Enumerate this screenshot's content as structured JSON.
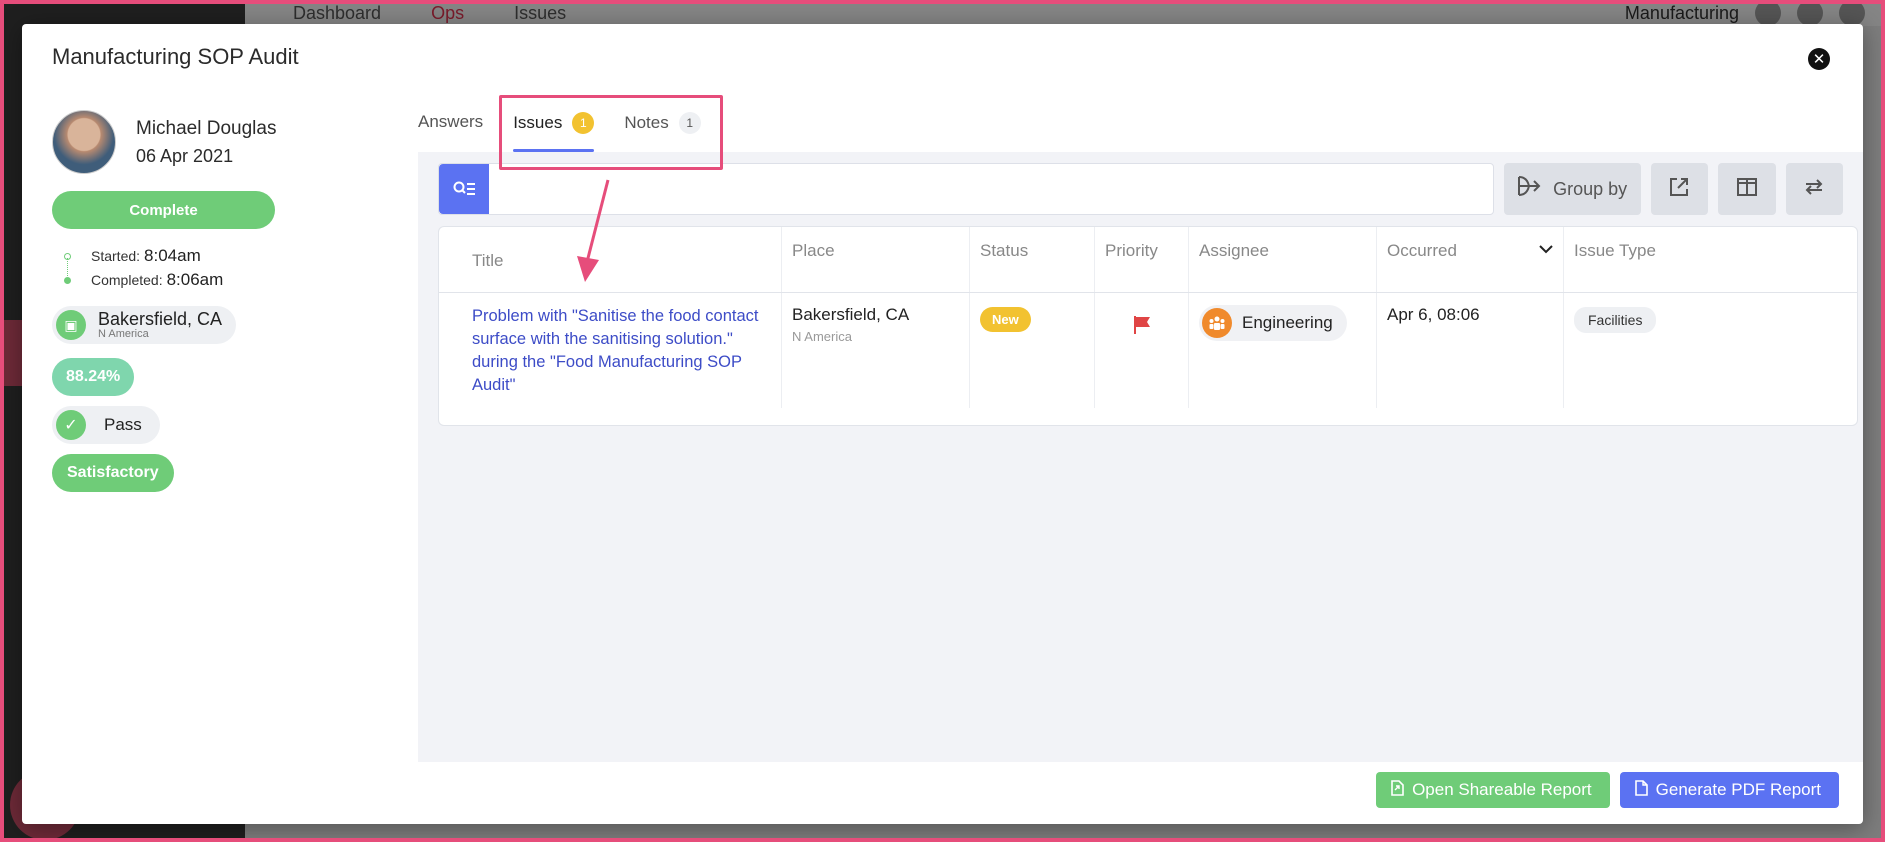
{
  "background": {
    "nav": [
      "Dashboard",
      "Ops",
      "Issues"
    ],
    "org": "Manufacturing"
  },
  "modal": {
    "title": "Manufacturing SOP Audit",
    "close_icon": "close-icon"
  },
  "user": {
    "name": "Michael Douglas",
    "date": "06 Apr 2021"
  },
  "audit": {
    "status": "Complete",
    "started_label": "Started:",
    "started_value": "8:04am",
    "completed_label": "Completed:",
    "completed_value": "8:06am",
    "place_name": "Bakersfield, CA",
    "place_region": "N America",
    "score": "88.24%",
    "result": "Pass",
    "rating": "Satisfactory"
  },
  "tabs": [
    {
      "label": "Answers",
      "count": ""
    },
    {
      "label": "Issues",
      "count": "1"
    },
    {
      "label": "Notes",
      "count": "1"
    }
  ],
  "toolbar": {
    "search_placeholder": "",
    "group_by_label": "Group by"
  },
  "table": {
    "columns": [
      "Title",
      "Place",
      "Status",
      "Priority",
      "Assignee",
      "Occurred",
      "Issue Type"
    ],
    "rows": [
      {
        "title": "Problem with \"Sanitise the food contact surface with the sanitising solution.\" during the \"Food Manufacturing SOP Audit\"",
        "place": "Bakersfield, CA",
        "region": "N America",
        "status": "New",
        "priority_icon": "flag-icon",
        "assignee": "Engineering",
        "occurred": "Apr 6, 08:06",
        "issue_type": "Facilities"
      }
    ]
  },
  "footer": {
    "shareable_label": "Open Shareable Report",
    "pdf_label": "Generate PDF Report"
  },
  "colors": {
    "accent": "#5b72f2",
    "success": "#6fcc78",
    "warning": "#f2c230",
    "highlight": "#e64d7b",
    "link": "#3d4cc7"
  }
}
